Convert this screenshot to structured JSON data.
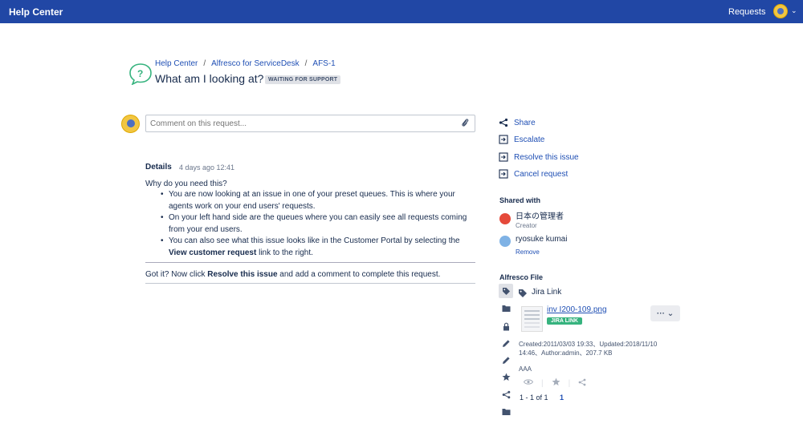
{
  "topbar": {
    "brand": "Help Center",
    "requests_label": "Requests",
    "chevron": "⌄"
  },
  "breadcrumb": [
    "Help Center",
    "Alfresco for ServiceDesk",
    "AFS-1"
  ],
  "request": {
    "title": "What am I looking at?",
    "status": "WAITING FOR SUPPORT"
  },
  "comment": {
    "placeholder": "Comment on this request..."
  },
  "details": {
    "title": "Details",
    "time": "4 days ago 12:41",
    "question": "Why do you need this?",
    "bullet1": "You are now looking at an issue in one of your preset queues. This is where your agents work on your end users' requests.",
    "bullet2": "On your left hand side are the queues where you can easily see all requests coming from your end users.",
    "bullet3_pre": "You can also see what this issue looks like in the Customer Portal by selecting the ",
    "bullet3_bold": "View customer request",
    "bullet3_post": " link to the right.",
    "gotit_pre": "Got it? Now click ",
    "gotit_bold": "Resolve this issue",
    "gotit_post": " and add a comment to complete this request."
  },
  "actions": [
    {
      "label": "Share",
      "icon": "share-icon"
    },
    {
      "label": "Escalate",
      "icon": "escalate-icon"
    },
    {
      "label": "Resolve this issue",
      "icon": "resolve-icon"
    },
    {
      "label": "Cancel request",
      "icon": "cancel-icon"
    }
  ],
  "shared_with": {
    "heading": "Shared with",
    "creator_name": "日本の管理者",
    "creator_role": "Creator",
    "other_name": "ryosuke kumai",
    "remove_label": "Remove"
  },
  "alfresco": {
    "heading": "Alfresco File",
    "jira_link_label": "Jira Link",
    "file_name": "inv I200-109.png",
    "badge": "JIRA LINK",
    "more_label": "··· ⌄",
    "meta": "Created:2011/03/03 19:33、Updated:2018/11/10 14:46、Author:admin、207.7 KB",
    "description": "AAA",
    "pager_range": "1 - 1 of 1",
    "pager_current": "1"
  },
  "colors": {
    "topbar": "#2147a5",
    "link": "#1f4fb4",
    "badge_green": "#36b37e"
  }
}
